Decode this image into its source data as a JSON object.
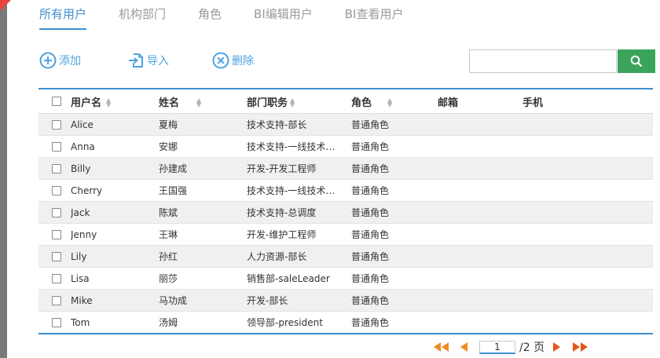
{
  "tabs": [
    {
      "label": "所有用户",
      "active": true
    },
    {
      "label": "机构部门"
    },
    {
      "label": "角色"
    },
    {
      "label": "BI编辑用户"
    },
    {
      "label": "BI查看用户"
    }
  ],
  "toolbar": {
    "add_label": "添加",
    "import_label": "导入",
    "delete_label": "删除"
  },
  "search": {
    "value": ""
  },
  "table": {
    "headers": {
      "username": "用户名",
      "name": "姓名",
      "dept": "部门职务",
      "role": "角色",
      "email": "邮箱",
      "phone": "手机"
    },
    "rows": [
      {
        "username": "Alice",
        "name": "夏梅",
        "dept": "技术支持-部长",
        "role": "普通角色",
        "email": "",
        "phone": ""
      },
      {
        "username": "Anna",
        "name": "安娜",
        "dept": "技术支持-一线技术…",
        "role": "普通角色",
        "email": "",
        "phone": ""
      },
      {
        "username": "Billy",
        "name": "孙建成",
        "dept": "开发-开发工程师",
        "role": "普通角色",
        "email": "",
        "phone": ""
      },
      {
        "username": "Cherry",
        "name": "王国强",
        "dept": "技术支持-一线技术…",
        "role": "普通角色",
        "email": "",
        "phone": ""
      },
      {
        "username": "Jack",
        "name": "陈斌",
        "dept": "技术支持-总调度",
        "role": "普通角色",
        "email": "",
        "phone": ""
      },
      {
        "username": "Jenny",
        "name": "王琳",
        "dept": "开发-维护工程师",
        "role": "普通角色",
        "email": "",
        "phone": ""
      },
      {
        "username": "Lily",
        "name": "孙红",
        "dept": "人力资源-部长",
        "role": "普通角色",
        "email": "",
        "phone": ""
      },
      {
        "username": "Lisa",
        "name": "丽莎",
        "dept": "销售部-saleLeader",
        "role": "普通角色",
        "email": "",
        "phone": ""
      },
      {
        "username": "Mike",
        "name": "马功成",
        "dept": "开发-部长",
        "role": "普通角色",
        "email": "",
        "phone": ""
      },
      {
        "username": "Tom",
        "name": "汤姆",
        "dept": "领导部-president",
        "role": "普通角色",
        "email": "",
        "phone": ""
      }
    ]
  },
  "pagination": {
    "current_page": "1",
    "total_label": "/2 页"
  },
  "colors": {
    "accent": "#3d8fd1",
    "search_button": "#3aa55a",
    "pager_arrows": "#f08a24"
  },
  "icons": {
    "add": "plus-circle-icon",
    "import": "import-icon",
    "delete": "x-circle-icon",
    "search": "search-icon",
    "first": "double-left-arrow-icon",
    "prev": "left-arrow-icon",
    "next": "right-arrow-icon",
    "last": "double-right-arrow-icon"
  }
}
